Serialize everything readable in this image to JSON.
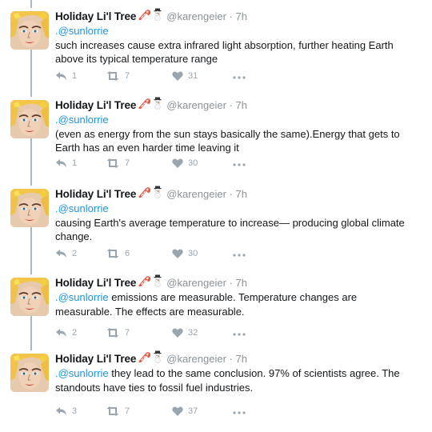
{
  "author": {
    "display_name": "Holiday Li'l Tree",
    "handle": "@karengeier",
    "timestamp": "7h",
    "emojis": [
      "cane-icon",
      "snowman-icon"
    ]
  },
  "separator": "·",
  "mention": ".@sunlorrie",
  "colors": {
    "mention": "#1b95e0",
    "name": "#14171a",
    "meta": "#8a9399",
    "action": "#9aa5ad",
    "thread_line": "#aab8c2"
  },
  "tweets": [
    {
      "mention_inline": false,
      "text": "such increases cause extra infrared light absorption, further heating Earth above its typical temperature range",
      "replies": "1",
      "retweets": "7",
      "likes": "31"
    },
    {
      "mention_inline": false,
      "text": "(even as energy from the sun stays basically the same).Energy that gets to Earth has an even harder time leaving it",
      "replies": "1",
      "retweets": "7",
      "likes": "30"
    },
    {
      "mention_inline": false,
      "text": "causing Earth's average temperature to increase— producing global climate change.",
      "replies": "2",
      "retweets": "6",
      "likes": "30"
    },
    {
      "mention_inline": true,
      "text": " emissions are measurable. Temperature changes are measurable. The effects are measurable.",
      "replies": "2",
      "retweets": "7",
      "likes": "32"
    },
    {
      "mention_inline": true,
      "text": " they lead to the same conclusion. 97% of scientists agree. The standouts have ties to fossil fuel industries.",
      "replies": "3",
      "retweets": "7",
      "likes": "37"
    }
  ],
  "icons": {
    "reply": "reply-icon",
    "retweet": "retweet-icon",
    "like": "heart-icon",
    "more": "more-dots-icon"
  }
}
